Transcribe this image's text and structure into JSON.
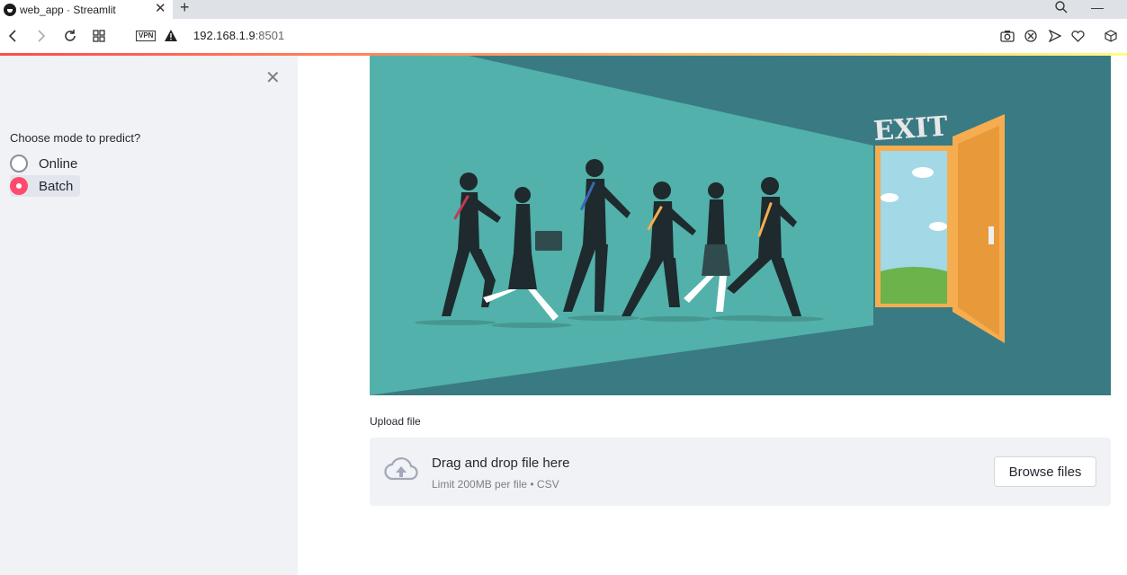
{
  "browser": {
    "tab_title": "web_app · Streamlit",
    "url_host": "192.168.1.9",
    "url_port": ":8501",
    "vpn_label": "VPN",
    "new_tab_glyph": "+",
    "close_glyph": "✕",
    "minimize_glyph": "—"
  },
  "sidebar": {
    "close_glyph": "✕",
    "radio_label": "Choose mode to predict?",
    "options": [
      {
        "label": "Online",
        "selected": false
      },
      {
        "label": "Batch",
        "selected": true
      }
    ]
  },
  "hero": {
    "exit_sign": "EXIT",
    "colors": {
      "wall": "#52b1aa",
      "dark": "#3a7a83",
      "door": "#f5ad4f",
      "sky": "#a3d8e6"
    }
  },
  "uploader": {
    "label": "Upload file",
    "drag_text": "Drag and drop file here",
    "limit_text": "Limit 200MB per file • CSV",
    "browse_label": "Browse files",
    "icon": "cloud-upload-icon"
  },
  "theme": {
    "primary": "#ff4b6e",
    "sidebar_bg": "#f0f2f6"
  }
}
